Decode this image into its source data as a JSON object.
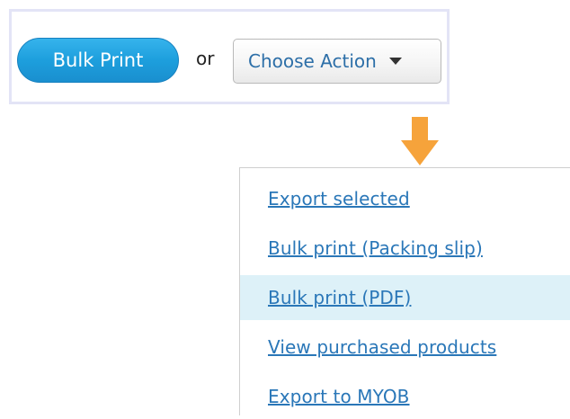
{
  "toolbar": {
    "bulk_print_label": "Bulk Print",
    "or_label": "or",
    "choose_action_label": "Choose Action"
  },
  "dropdown": {
    "items": [
      {
        "label": "Export selected"
      },
      {
        "label": "Bulk print (Packing slip)"
      },
      {
        "label": "Bulk print (PDF)",
        "highlighted": true
      },
      {
        "label": "View purchased products"
      },
      {
        "label": "Export to MYOB"
      }
    ]
  },
  "colors": {
    "primary_button": "#1d9fdd",
    "link": "#2a77b8",
    "highlight_row": "#ddf1f8",
    "arrow": "#f6a33b",
    "panel_border": "#e3e4f6"
  },
  "icons": {
    "caret": "caret-down-icon",
    "arrow": "arrow-down-icon"
  }
}
